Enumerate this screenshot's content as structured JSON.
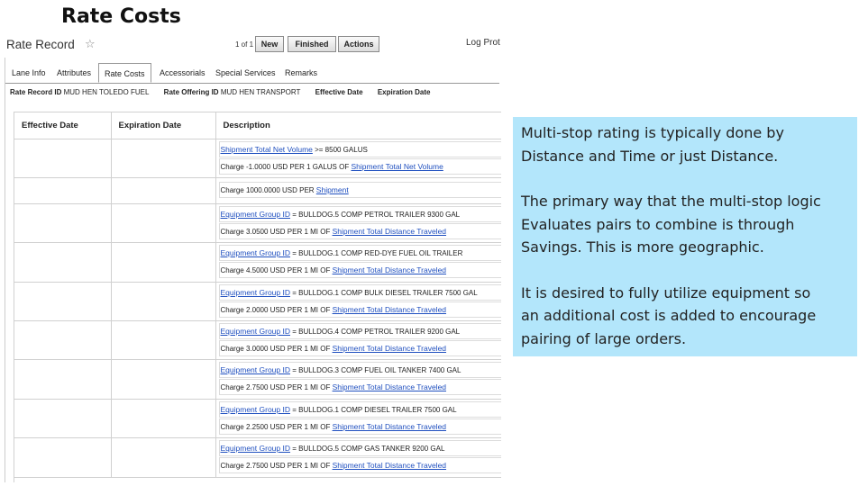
{
  "slide": {
    "title": "Rate Costs"
  },
  "header": {
    "record_title": "Rate Record",
    "star_glyph": "☆",
    "pager": "1 of 1",
    "buttons": {
      "new": "New",
      "finished": "Finished",
      "actions": "Actions"
    },
    "log_label": "Log Prot"
  },
  "tabs": [
    {
      "label": "Lane Info",
      "active": false
    },
    {
      "label": "Attributes",
      "active": false
    },
    {
      "label": "Rate Costs",
      "active": true
    },
    {
      "label": "Accessorials",
      "active": false
    },
    {
      "label": "Special Services",
      "active": false
    },
    {
      "label": "Remarks",
      "active": false
    }
  ],
  "infobar": {
    "rate_record_label": "Rate Record ID",
    "rate_record_value": "MUD HEN TOLEDO FUEL",
    "rate_offering_label": "Rate Offering ID",
    "rate_offering_value": "MUD HEN TRANSPORT",
    "effective_date_label": "Effective Date",
    "expiration_date_label": "Expiration Date"
  },
  "grid": {
    "columns": [
      "Effective Date",
      "Expiration Date",
      "Description"
    ],
    "rows": [
      {
        "condition": {
          "link": "Shipment Total Net Volume",
          "text": " >= 8500 GALUS"
        },
        "charge": {
          "text": "Charge -1.0000 USD PER 1 GALUS OF ",
          "link": "Shipment Total Net Volume"
        }
      },
      {
        "charge": {
          "text": "Charge 1000.0000 USD PER ",
          "link": "Shipment"
        }
      },
      {
        "condition": {
          "link": "Equipment Group ID",
          "text": " = BULLDOG.5 COMP PETROL TRAILER 9300 GAL"
        },
        "charge": {
          "text": "Charge 3.0500 USD PER 1 MI OF ",
          "link": "Shipment Total Distance Traveled"
        }
      },
      {
        "condition": {
          "link": "Equipment Group ID",
          "text": " = BULLDOG.1 COMP RED-DYE FUEL OIL TRAILER"
        },
        "charge": {
          "text": "Charge 4.5000 USD PER 1 MI OF ",
          "link": "Shipment Total Distance Traveled"
        }
      },
      {
        "condition": {
          "link": "Equipment Group ID",
          "text": " = BULLDOG.1 COMP BULK DIESEL TRAILER 7500 GAL"
        },
        "charge": {
          "text": "Charge 2.0000 USD PER 1 MI OF ",
          "link": "Shipment Total Distance Traveled"
        }
      },
      {
        "condition": {
          "link": "Equipment Group ID",
          "text": " = BULLDOG.4 COMP PETROL TRAILER 9200 GAL"
        },
        "charge": {
          "text": "Charge 3.0000 USD PER 1 MI OF ",
          "link": "Shipment Total Distance Traveled"
        }
      },
      {
        "condition": {
          "link": "Equipment Group ID",
          "text": " = BULLDOG.3 COMP FUEL OIL TANKER 7400 GAL"
        },
        "charge": {
          "text": "Charge 2.7500 USD PER 1 MI OF ",
          "link": "Shipment Total Distance Traveled"
        }
      },
      {
        "condition": {
          "link": "Equipment Group ID",
          "text": " = BULLDOG.1 COMP DIESEL TRAILER 7500 GAL"
        },
        "charge": {
          "text": "Charge 2.2500 USD PER 1 MI OF ",
          "link": "Shipment Total Distance Traveled"
        }
      },
      {
        "condition": {
          "link": "Equipment Group ID",
          "text": " = BULLDOG.5 COMP GAS TANKER 9200 GAL"
        },
        "charge": {
          "text": "Charge 2.7500 USD PER 1 MI OF ",
          "link": "Shipment Total Distance Traveled"
        }
      }
    ]
  },
  "note": {
    "paragraphs": [
      "Multi-stop rating is typically done by\nDistance and Time or just Distance.",
      "The primary way that the multi-stop logic\nEvaluates pairs to combine is through\nSavings.  This is more geographic.",
      "It is desired to fully utilize equipment so\nan additional cost is added to encourage\npairing of large orders."
    ]
  },
  "colors": {
    "note_background": "#b3e6fb",
    "link": "#1f4fbf"
  }
}
